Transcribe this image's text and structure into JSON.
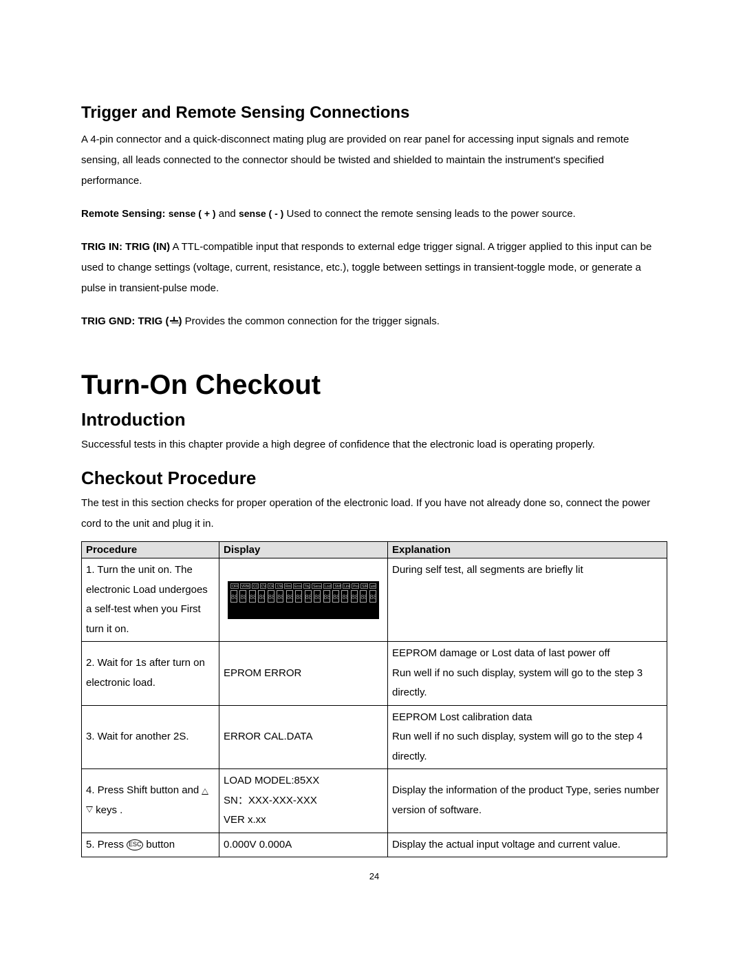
{
  "section1": {
    "title": "Trigger and Remote Sensing Connections",
    "intro": "A 4-pin connector and a quick-disconnect mating plug are provided on rear panel for accessing input signals and remote sensing, all leads connected to the connector should be twisted and shielded to maintain the instrument's specified performance.",
    "remote_label": "Remote Sensing:",
    "remote_sense_a": "sense ( + )",
    "remote_and": " and ",
    "remote_sense_b": "sense  ( - )",
    "remote_text": " Used to connect the remote sensing leads to the power source.",
    "trigin_label": "TRIG IN: TRIG (IN)",
    "trigin_text": " A TTL-compatible input that responds to external edge trigger signal. A trigger applied to this input can be used to change settings (voltage, current, resistance, etc.), toggle between settings in transient-toggle mode, or generate a pulse in transient-pulse mode.",
    "triggnd_label_a": "TRIG GND: TRIG (",
    "triggnd_label_b": ")",
    "triggnd_text": " Provides the common connection for the trigger signals."
  },
  "section2": {
    "main_title": "Turn-On Checkout",
    "intro_title": "Introduction",
    "intro_text": "Successful tests in this chapter provide a high degree of confidence that the electronic load is operating properly.",
    "proc_title": "Checkout Procedure",
    "proc_text": "The test in this section checks for proper operation of the electronic load. If you have not already done so, connect the power cord to the unit and plug it in."
  },
  "table": {
    "headers": {
      "proc": "Procedure",
      "disp": "Display",
      "exp": "Explanation"
    },
    "row1": {
      "proc": "1. Turn the unit on.      The electronic Load undergoes a self-test when you First turn it on.",
      "exp": "During self test, all segments are briefly lit",
      "vfd_indicators": [
        "OFF",
        "VRNG",
        "CC",
        "CV",
        "CR",
        "CW",
        "Rmt",
        "Error",
        "Trig",
        "Sense",
        "Lock",
        "Shift",
        "Link",
        "Prot",
        "S/R",
        "unit"
      ]
    },
    "row2": {
      "proc": "2. Wait for 1s after turn on electronic load.",
      "disp": "EPROM ERROR",
      "exp": "EEPROM damage or Lost data of last power off\nRun well if no such display, system will go to the step 3 directly."
    },
    "row3": {
      "proc": "3. Wait for another 2S.",
      "disp": "ERROR CAL.DATA",
      "exp": "EEPROM Lost calibration data\nRun well if no such display, system will go to the step 4 directly."
    },
    "row4": {
      "proc_a": "4. Press Shift button and ",
      "proc_b": "keys .",
      "disp": "LOAD MODEL:85XX\nSN：XXX-XXX-XXX\nVER x.xx",
      "exp": "Display the information of the product Type, series number version of software."
    },
    "row5": {
      "proc_a": "5. Press ",
      "proc_b": " button",
      "esc": "ESC",
      "disp": "0.000V    0.000A",
      "exp": "Display the actual input voltage and current value."
    }
  },
  "page_number": "24"
}
